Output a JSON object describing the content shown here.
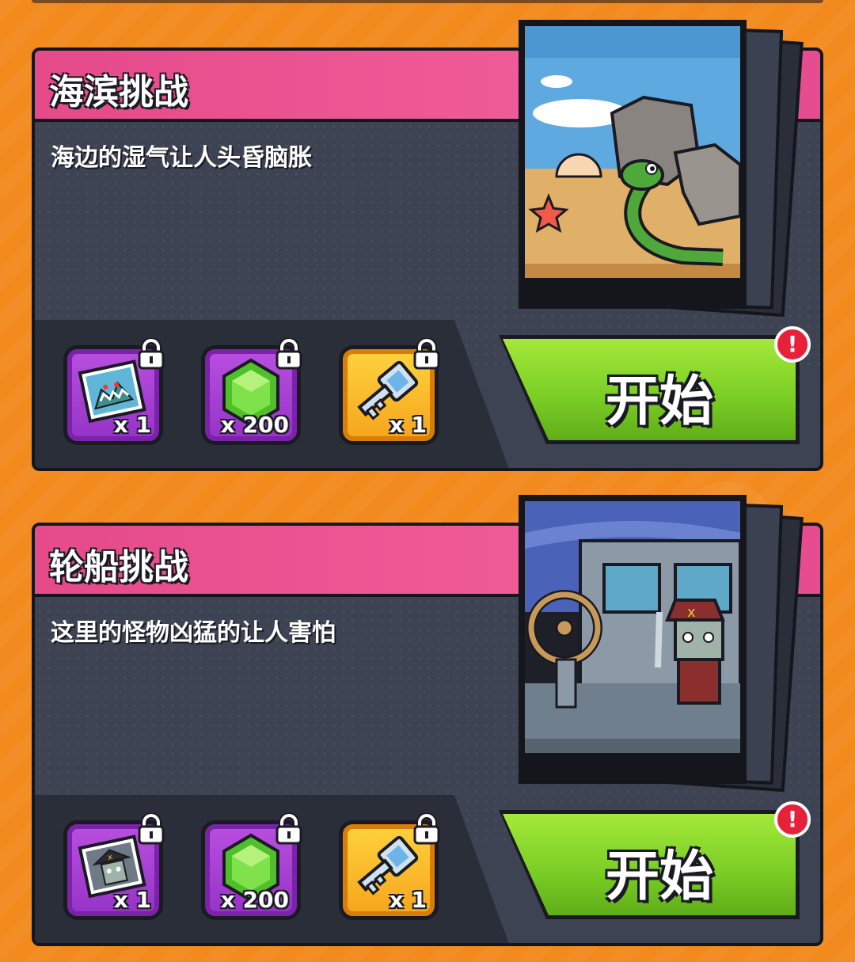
{
  "challenges": [
    {
      "title": "海滨挑战",
      "description": "海边的湿气让人头昏脑胀",
      "start_label": "开始",
      "alert": "!",
      "scene_icon": "beach-snake-scene",
      "rewards": [
        {
          "icon": "monster-card-icon",
          "qty": "x 1",
          "locked": true
        },
        {
          "icon": "green-gem-icon",
          "qty": "x 200",
          "locked": true
        },
        {
          "icon": "key-icon",
          "qty": "x 1",
          "locked": true
        }
      ]
    },
    {
      "title": "轮船挑战",
      "description": "这里的怪物凶猛的让人害怕",
      "start_label": "开始",
      "alert": "!",
      "scene_icon": "ship-pirate-scene",
      "rewards": [
        {
          "icon": "pirate-card-icon",
          "qty": "x 1",
          "locked": true
        },
        {
          "icon": "green-gem-icon",
          "qty": "x 200",
          "locked": true
        },
        {
          "icon": "key-icon",
          "qty": "x 1",
          "locked": true
        }
      ]
    }
  ],
  "colors": {
    "background": "#f28a1e",
    "title_bar": "#e54a8a",
    "panel": "#3d4352",
    "start_button": "#7ccf26",
    "alert": "#e8213a"
  }
}
